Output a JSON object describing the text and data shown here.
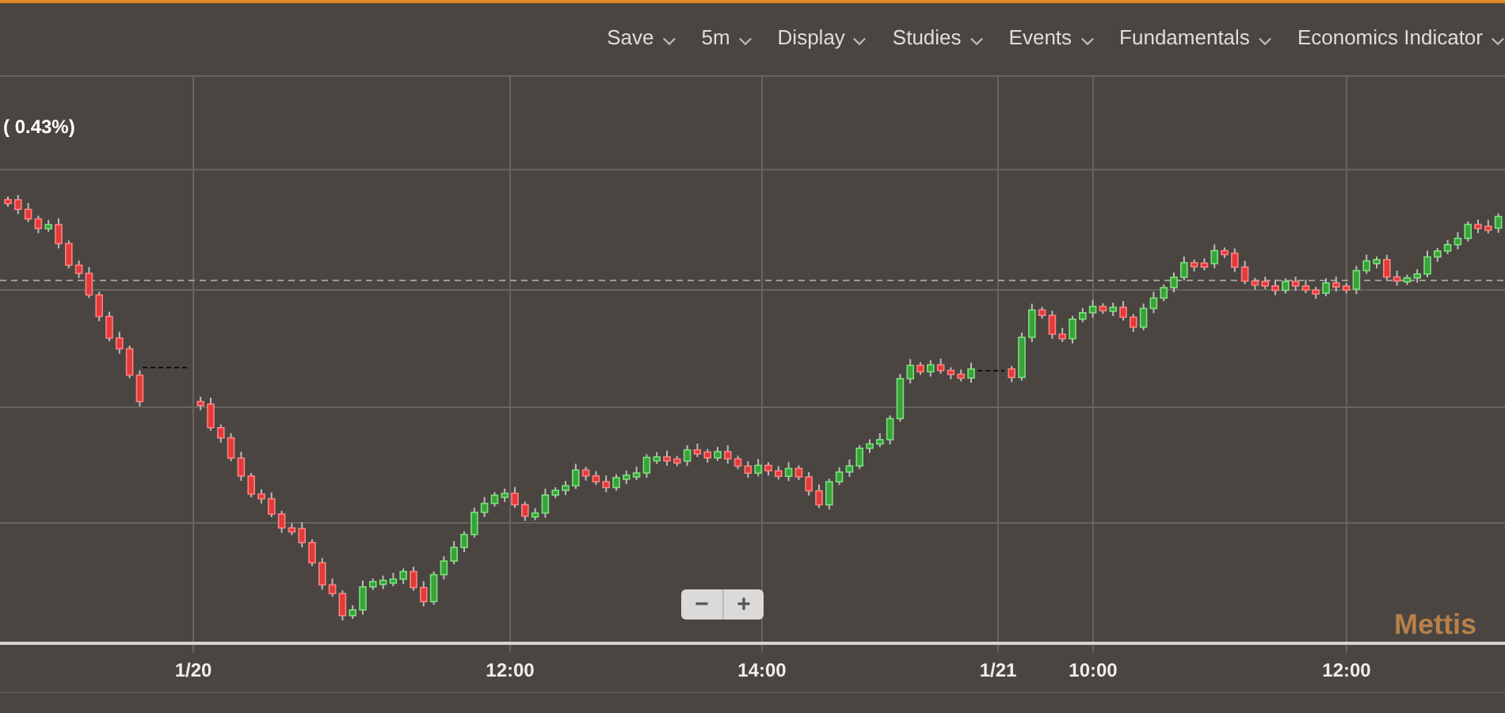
{
  "toolbar": {
    "menus": [
      {
        "label": "Save"
      },
      {
        "label": "5m"
      },
      {
        "label": "Display"
      },
      {
        "label": "Studies"
      },
      {
        "label": "Events"
      },
      {
        "label": "Fundamentals"
      },
      {
        "label": "Economics Indicator"
      }
    ]
  },
  "price_change": "( 0.43%)",
  "x_axis": {
    "labels": [
      "1/20",
      "12:00",
      "14:00",
      "1/21",
      "10:00",
      "12:00"
    ]
  },
  "zoom_controls": [
    {
      "label": "−"
    },
    {
      "label": "+"
    }
  ],
  "brand_logo": "Mettis"
}
